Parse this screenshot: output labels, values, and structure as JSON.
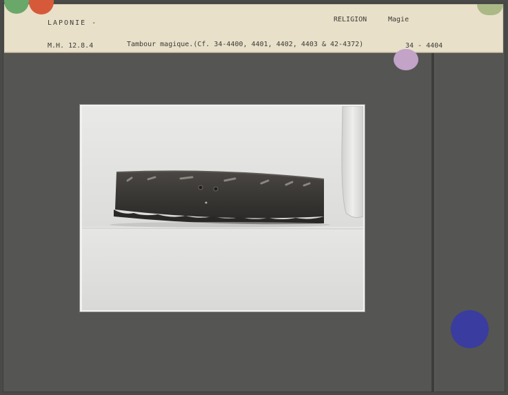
{
  "record": {
    "region": "LAPONIE -",
    "category": "RELIGION",
    "subcategory": "Magie",
    "reference": "M.H. 12.8.4",
    "title": "Tambour magique.(Cf. 34-4400, 4401, 4402, 4403 & 42-4372)",
    "number": "34 - 4404"
  },
  "photo": {
    "subject": "drum-photo"
  },
  "colors": {
    "label_paper": "#e9e0c9",
    "mount": "#555553",
    "sticker_green": "#6aa86a",
    "sticker_red": "#d65a3a",
    "sticker_lilac": "#c3a3c8",
    "sticker_blue": "#3a3ca0"
  }
}
